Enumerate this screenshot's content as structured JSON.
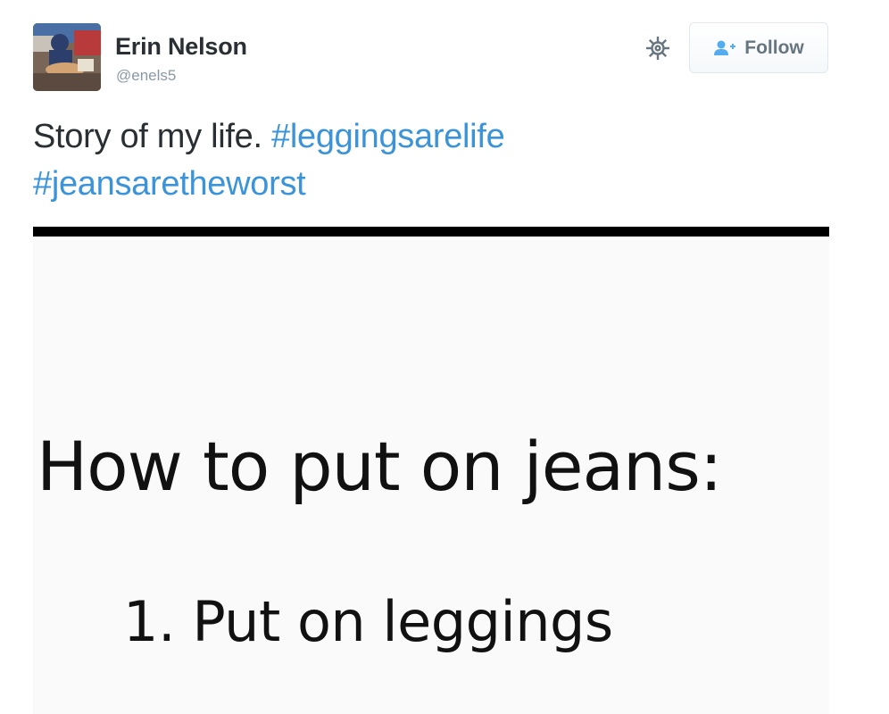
{
  "author": {
    "name": "Erin Nelson",
    "handle": "@enels5",
    "avatar_icon": "profile-photo"
  },
  "actions": {
    "settings_icon": "gear-icon",
    "follow_label": "Follow",
    "follow_icon": "add-user-icon"
  },
  "tweet": {
    "text": "Story of my life.",
    "hashtags": [
      "#leggingsarelife",
      "#jeansaretheworst"
    ]
  },
  "media": {
    "heading": "How to put on jeans:",
    "step_1": "1. Put on leggings"
  },
  "colors": {
    "link": "#3b94d9",
    "text": "#292f33",
    "muted": "#8899a6"
  }
}
